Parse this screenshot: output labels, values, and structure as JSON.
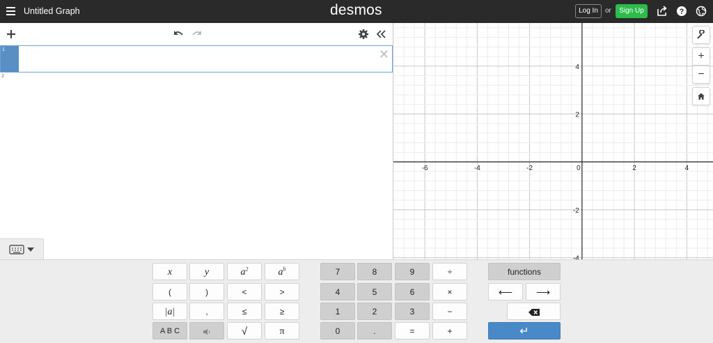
{
  "topbar": {
    "title": "Untitled Graph",
    "logo": "desmos",
    "login_label": "Log In",
    "or_label": "or",
    "signup_label": "Sign Up",
    "icons": [
      "share-icon",
      "help-icon",
      "globe-icon"
    ]
  },
  "expressions": {
    "rows": [
      {
        "number": "1",
        "value": ""
      },
      {
        "number": "2",
        "value": ""
      }
    ]
  },
  "graph": {
    "x_ticks": [
      "-6",
      "-4",
      "-2",
      "0",
      "2",
      "4"
    ],
    "y_ticks": [
      "4",
      "2",
      "-2",
      "-4"
    ],
    "x_range": [
      -7.2,
      5.0
    ],
    "y_range": [
      -4.1,
      5.8
    ],
    "grid": true,
    "major_step": 2,
    "minor_step": 0.4
  },
  "keypad": {
    "math_keys": [
      [
        "x",
        "y",
        "a",
        "a"
      ],
      [
        "(",
        ")",
        "<",
        ">"
      ],
      [
        "|a|",
        ",",
        "≤",
        "≥"
      ],
      [
        "A B C",
        "",
        "√",
        "π"
      ]
    ],
    "num_keys": [
      [
        "7",
        "8",
        "9",
        "÷"
      ],
      [
        "4",
        "5",
        "6",
        "×"
      ],
      [
        "1",
        "2",
        "3",
        "−"
      ],
      [
        "0",
        ".",
        "=",
        "+"
      ]
    ],
    "sup_2": "2",
    "sup_b": "b",
    "functions_label": "functions",
    "left_arrow": "⟵",
    "right_arrow": "⟶",
    "enter_symbol": "↵"
  },
  "colors": {
    "topbar": "#2a2a2a",
    "signup": "#2dbb4b",
    "active_row": "#5a8fc4",
    "enter_key": "#4a89c8"
  }
}
